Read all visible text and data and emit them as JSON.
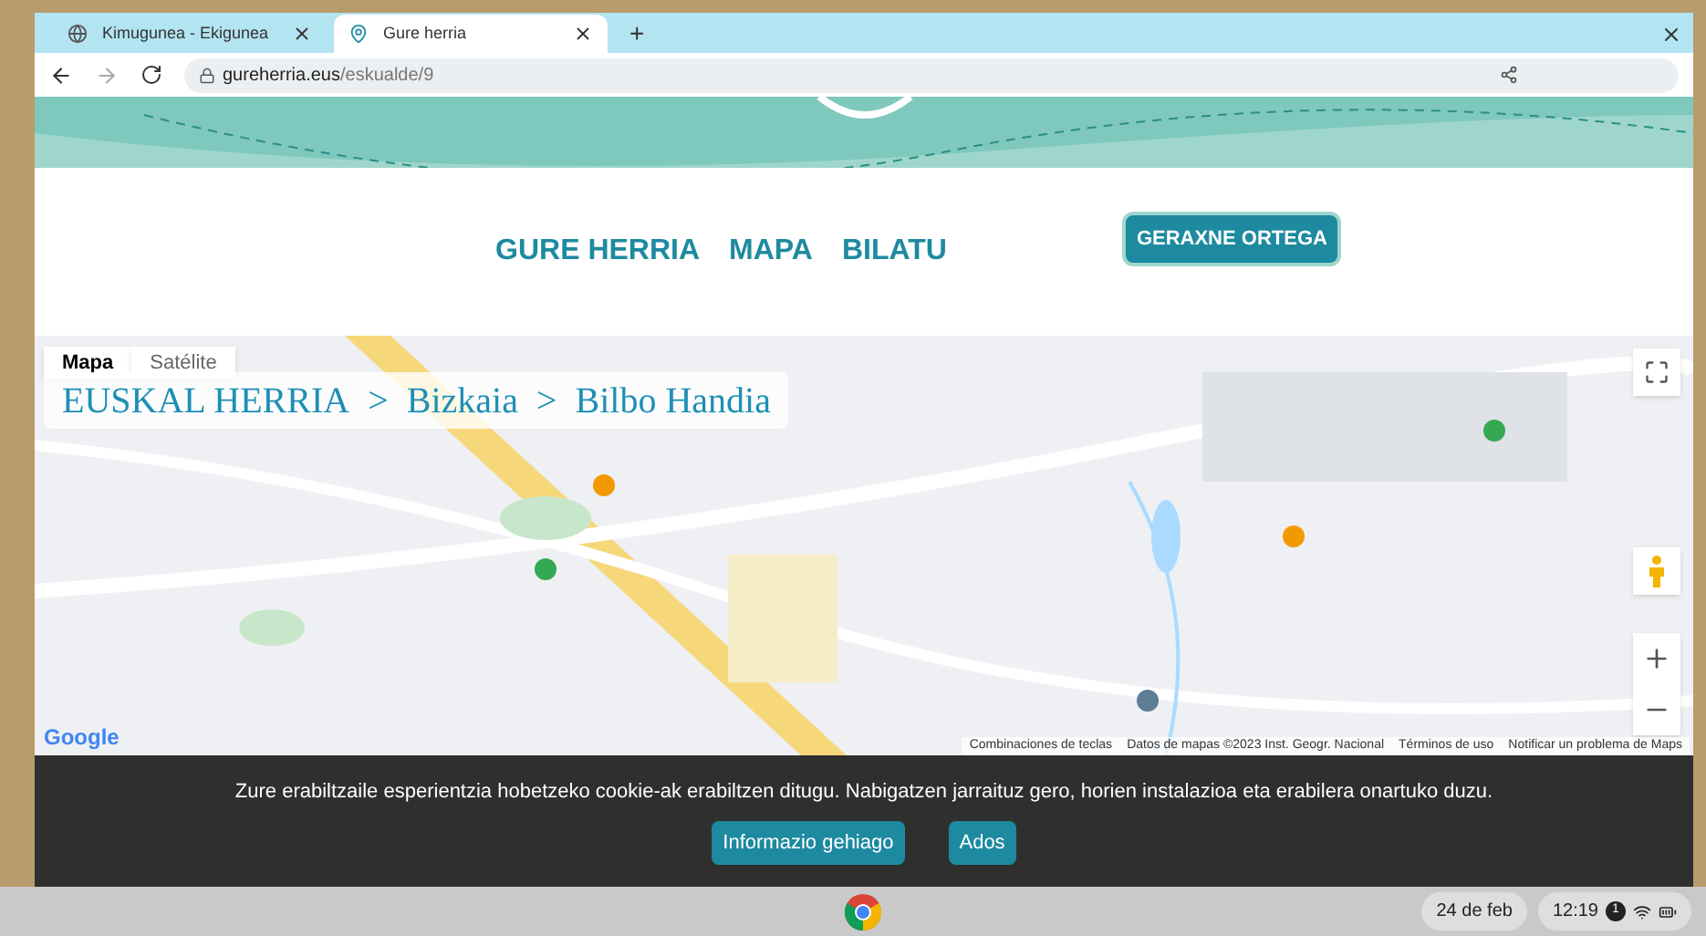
{
  "browser": {
    "tabs": [
      {
        "title": "Kimugunea - Ekigunea",
        "selected": false
      },
      {
        "title": "Gure herria",
        "selected": true
      }
    ],
    "new_tab": "+",
    "url_host": "gureherria.eus",
    "url_path": "/eskualde/9"
  },
  "nav": {
    "links": [
      {
        "label": "GURE HERRIA"
      },
      {
        "label": "MAPA"
      },
      {
        "label": "BILATU"
      }
    ],
    "user_button": "GERAXNE ORTEGA"
  },
  "map": {
    "kind": "picture",
    "type_buttons": [
      {
        "label": "Mapa",
        "selected": true
      },
      {
        "label": "Satélite",
        "selected": false
      }
    ],
    "breadcrumb": [
      "EUSKAL HERRIA",
      "Bizkaia",
      "Bilbo Handia"
    ],
    "separator": ">",
    "logo": "Google",
    "attribution": [
      "Combinaciones de teclas",
      "Datos de mapas ©2023 Inst. Geogr. Nacional",
      "Términos de uso",
      "Notificar un problema de Maps"
    ]
  },
  "cookie": {
    "text": "Zure erabiltzaile esperientzia hobetzeko cookie-ak erabiltzen ditugu. Nabigatzen jarraituz gero, horien instalazioa eta erabilera onartuko duzu.",
    "buttons": [
      "Informazio gehiago",
      "Ados"
    ]
  },
  "shelf": {
    "date": "24 de feb",
    "time": "12:19",
    "notification_count": "1"
  }
}
